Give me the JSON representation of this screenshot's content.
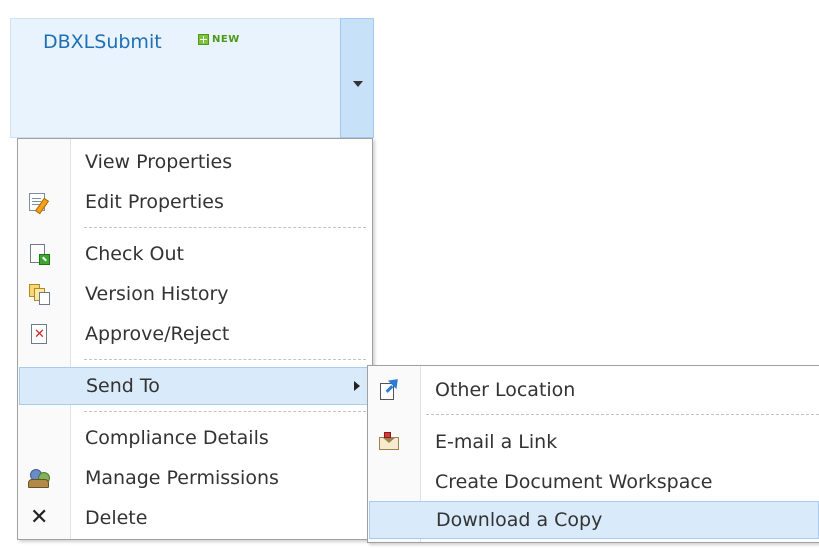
{
  "item": {
    "title": "DBXLSubmit",
    "new_badge": "NEW"
  },
  "colors": {
    "header_bg": "#e8f3fd",
    "title_text": "#1f6fb3",
    "highlight_bg": "#d9eafa",
    "highlight_border": "#a8cbee",
    "new_badge": "#4e9a16"
  },
  "menu": {
    "items": [
      {
        "label": "View Properties",
        "icon": ""
      },
      {
        "label": "Edit Properties",
        "icon": "edit-properties-icon"
      },
      {
        "label": "Check Out",
        "icon": "check-out-icon"
      },
      {
        "label": "Version History",
        "icon": "version-history-icon"
      },
      {
        "label": "Approve/Reject",
        "icon": "approve-reject-icon"
      },
      {
        "label": "Send To",
        "icon": "",
        "has_submenu": true,
        "highlighted": true
      },
      {
        "label": "Compliance Details",
        "icon": ""
      },
      {
        "label": "Manage Permissions",
        "icon": "manage-permissions-icon"
      },
      {
        "label": "Delete",
        "icon": "delete-icon"
      }
    ]
  },
  "submenu": {
    "items": [
      {
        "label": "Other Location",
        "icon": "send-to-other-location-icon"
      },
      {
        "label": "E-mail a Link",
        "icon": "email-link-icon"
      },
      {
        "label": "Create Document Workspace",
        "icon": ""
      },
      {
        "label": "Download a Copy",
        "icon": "",
        "highlighted": true
      }
    ]
  }
}
